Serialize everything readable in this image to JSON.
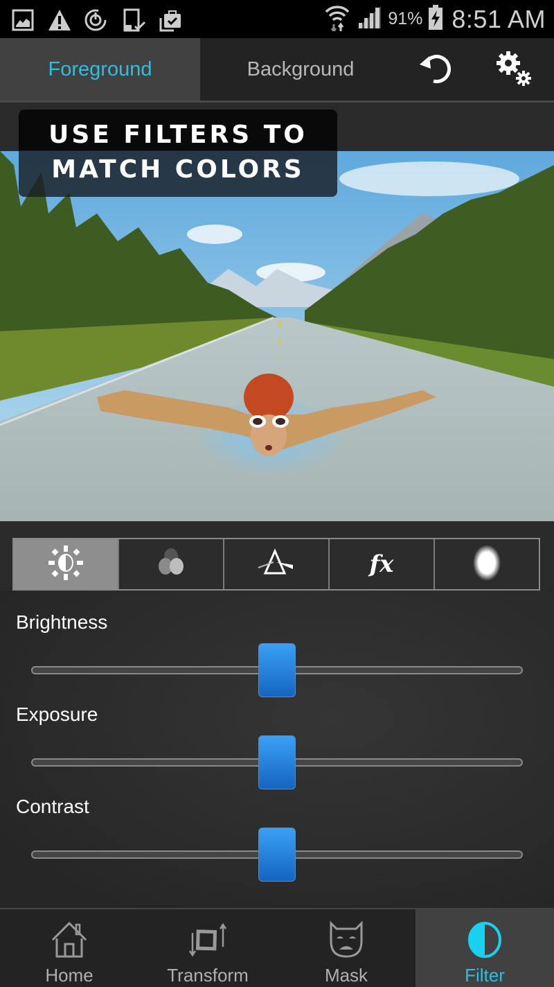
{
  "status_bar": {
    "left_icons": [
      "gallery-notification-icon",
      "warning-icon",
      "sync-icon",
      "device-check-icon",
      "clipboard-check-icon"
    ],
    "battery_percent": "91%",
    "time": "8:51 AM"
  },
  "top_bar": {
    "tabs": [
      {
        "label": "Foreground",
        "active": true
      },
      {
        "label": "Background",
        "active": false
      }
    ],
    "undo_icon": "undo-icon",
    "settings_icon": "settings-icon"
  },
  "banner": {
    "line1": "USE FILTERS TO",
    "line2": "MATCH COLORS"
  },
  "filter_tabs": [
    {
      "icon": "brightness-icon",
      "active": true
    },
    {
      "icon": "color-channels-icon",
      "active": false
    },
    {
      "icon": "prism-icon",
      "active": false
    },
    {
      "icon": "fx-icon",
      "label": "fx",
      "active": false
    },
    {
      "icon": "blur-icon",
      "active": false
    }
  ],
  "sliders": [
    {
      "label": "Brightness",
      "value": 0.5
    },
    {
      "label": "Exposure",
      "value": 0.5
    },
    {
      "label": "Contrast",
      "value": 0.5
    }
  ],
  "bottom_nav": [
    {
      "label": "Home",
      "icon": "home-icon",
      "active": false
    },
    {
      "label": "Transform",
      "icon": "transform-icon",
      "active": false
    },
    {
      "label": "Mask",
      "icon": "mask-icon",
      "active": false
    },
    {
      "label": "Filter",
      "icon": "filter-icon",
      "active": true
    }
  ],
  "colors": {
    "accent": "#2cc0e0",
    "slider_thumb": "#1e7fe0"
  }
}
